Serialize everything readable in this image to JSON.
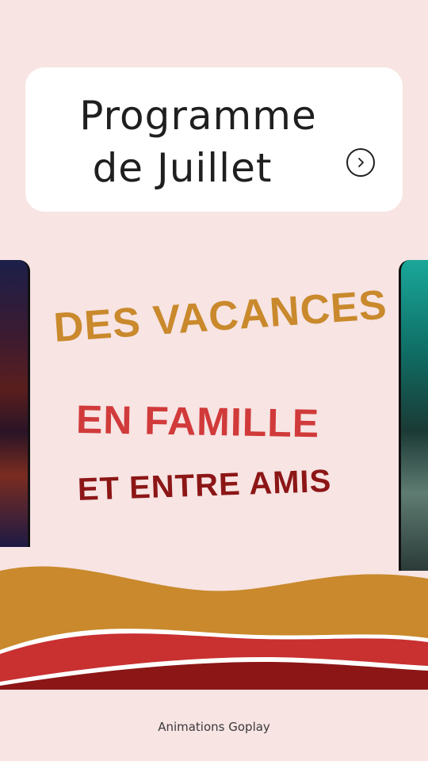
{
  "title": {
    "line1": "Programme",
    "line2": "de Juillet"
  },
  "tagline": {
    "line1": "DES VACANCES",
    "line2": "EN FAMILLE",
    "line3": "ET ENTRE AMIS"
  },
  "footer": {
    "credit": "Animations Goplay"
  },
  "colors": {
    "background": "#f7e4e3",
    "accent_gold": "#c9892c",
    "accent_red": "#d13a3a",
    "accent_dark_red": "#8c1616"
  },
  "icons": {
    "next": "chevron-right-icon"
  }
}
